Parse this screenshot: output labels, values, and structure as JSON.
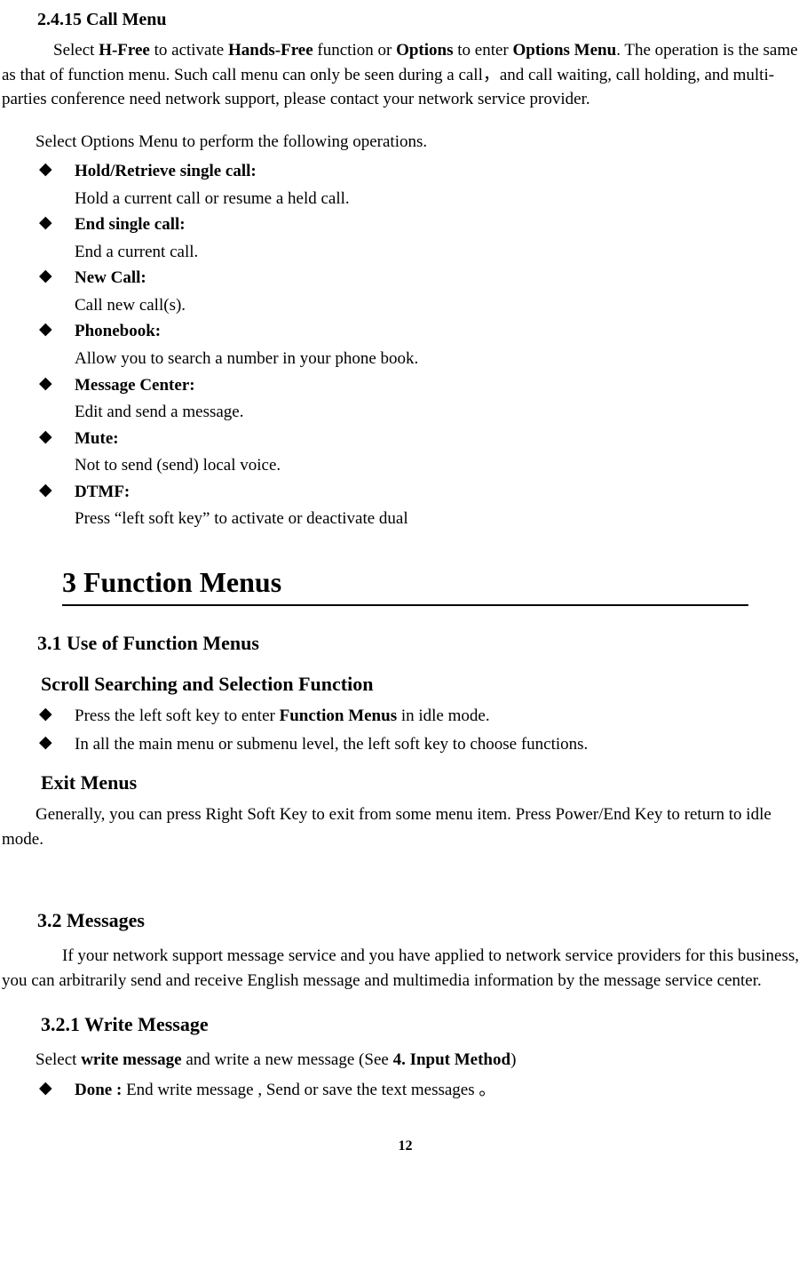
{
  "sec2415": {
    "heading": "2.4.15 Call Menu",
    "para_pre": "Select ",
    "hfree": "H-Free",
    "para_mid1": " to activate ",
    "handsfree": "Hands-Free",
    "para_mid2": " function or ",
    "options": "Options",
    "para_mid3": " to enter ",
    "options_menu": "Options Menu",
    "para_post": ". The operation is the same as that of function menu. Such call menu can only be seen during a call，and call waiting, call holding, and multi-parties conference need network support, please contact your network service provider.",
    "intro": "Select Options Menu to perform the following operations.",
    "items": [
      {
        "term": "Hold/Retrieve single call:",
        "desc": "Hold a current call or resume a held call."
      },
      {
        "term": "End single call:",
        "desc": "End a current call."
      },
      {
        "term": "New Call:",
        "desc": "Call new call(s)."
      },
      {
        "term": "Phonebook:",
        "desc": "Allow you to search a number in your phone book."
      },
      {
        "term": "Message Center:",
        "desc": "Edit and send a message."
      },
      {
        "term": "Mute:",
        "desc": "Not to send (send) local voice."
      },
      {
        "term": "DTMF:",
        "desc": "Press “left soft key” to activate or deactivate dual"
      }
    ]
  },
  "sec3": {
    "heading": "3 Function Menus",
    "sec31": {
      "heading": "3.1 Use of Function Menus",
      "scroll_heading": "Scroll Searching and Selection Function",
      "scroll_items": [
        {
          "pre": "Press the left soft key to enter ",
          "bold": "Function Menus",
          "post": " in idle mode."
        },
        {
          "text": "In all the main menu or submenu level, the left soft key to choose functions."
        }
      ],
      "exit_heading": "Exit Menus",
      "exit_para": "Generally, you can press Right Soft Key to exit from some menu item. Press Power/End Key to return to idle mode."
    },
    "sec32": {
      "heading": "3.2 Messages",
      "para": "If your network support message service and you have applied to network service providers for this business, you can arbitrarily send and receive English message and multimedia information by the message service center."
    },
    "sec321": {
      "heading": "3.2.1 Write Message",
      "para_pre": "Select ",
      "write_msg": "write message",
      "para_mid": " and write a new message (See ",
      "input_method": "4. Input Method",
      "para_post": ")",
      "items": [
        {
          "term": "Done :",
          "desc": " End write message , Send or save the text messages 。"
        }
      ]
    }
  },
  "page_number": "12",
  "diamond_glyph": "◆"
}
